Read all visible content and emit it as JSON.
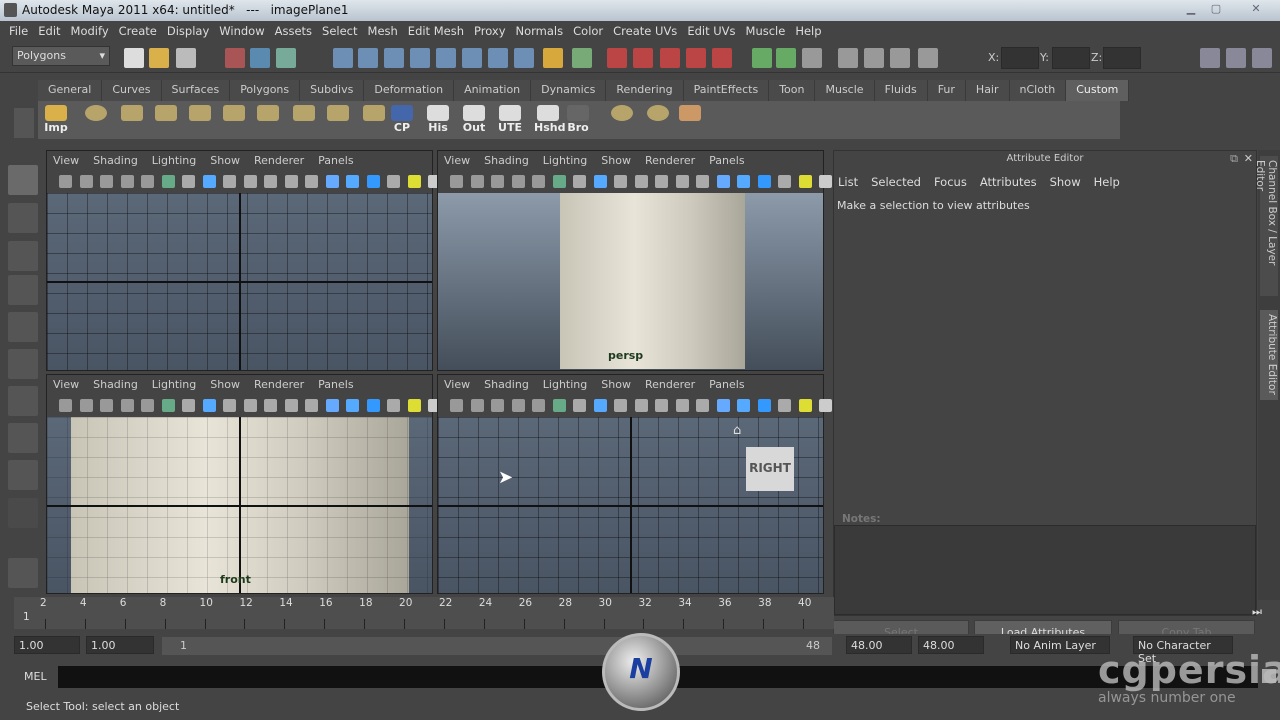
{
  "title": "Autodesk Maya 2011 x64: untitled*   ---   imagePlane1",
  "menus": [
    "File",
    "Edit",
    "Modify",
    "Create",
    "Display",
    "Window",
    "Assets",
    "Select",
    "Mesh",
    "Edit Mesh",
    "Proxy",
    "Normals",
    "Color",
    "Create UVs",
    "Edit UVs",
    "Muscle",
    "Help"
  ],
  "status": {
    "mode": "Polygons",
    "x_label": "X:",
    "y_label": "Y:",
    "z_label": "Z:"
  },
  "shelf": {
    "tabs": [
      "General",
      "Curves",
      "Surfaces",
      "Polygons",
      "Subdivs",
      "Deformation",
      "Animation",
      "Dynamics",
      "Rendering",
      "PaintEffects",
      "Toon",
      "Muscle",
      "Fluids",
      "Fur",
      "Hair",
      "nCloth",
      "Custom"
    ],
    "active_tab": "Custom",
    "labeled_items": [
      "Imp",
      "CP",
      "His",
      "Out",
      "UTE",
      "Hshd",
      "Bro"
    ]
  },
  "viewport_menu": [
    "View",
    "Shading",
    "Lighting",
    "Show",
    "Renderer",
    "Panels"
  ],
  "viewports": {
    "persp": "persp",
    "front": "front",
    "viewcube": "RIGHT"
  },
  "attribute_editor": {
    "title": "Attribute Editor",
    "menu": [
      "List",
      "Selected",
      "Focus",
      "Attributes",
      "Show",
      "Help"
    ],
    "message": "Make a selection to view attributes",
    "notes_label": "Notes:",
    "buttons": [
      "Select",
      "Load Attributes",
      "Copy Tab"
    ]
  },
  "right_tabs": [
    "Channel Box / Layer Editor",
    "Attribute Editor"
  ],
  "timeslider": {
    "ticks": [
      "2",
      "4",
      "6",
      "8",
      "10",
      "12",
      "14",
      "16",
      "18",
      "20",
      "22",
      "24",
      "26",
      "28",
      "30",
      "32",
      "34",
      "36",
      "38",
      "40"
    ],
    "current": "1"
  },
  "range": {
    "start": "1.00",
    "playback_start": "1.00",
    "range_start": "1",
    "range_end": "48",
    "playback_end": "48.00",
    "end": "48.00",
    "anim_layer": "No Anim Layer",
    "character_set": "No Character Set"
  },
  "command": {
    "label": "MEL"
  },
  "help_line": "Select Tool: select an object",
  "watermark": {
    "brand": "cgpersia",
    "tagline": "always number one"
  }
}
